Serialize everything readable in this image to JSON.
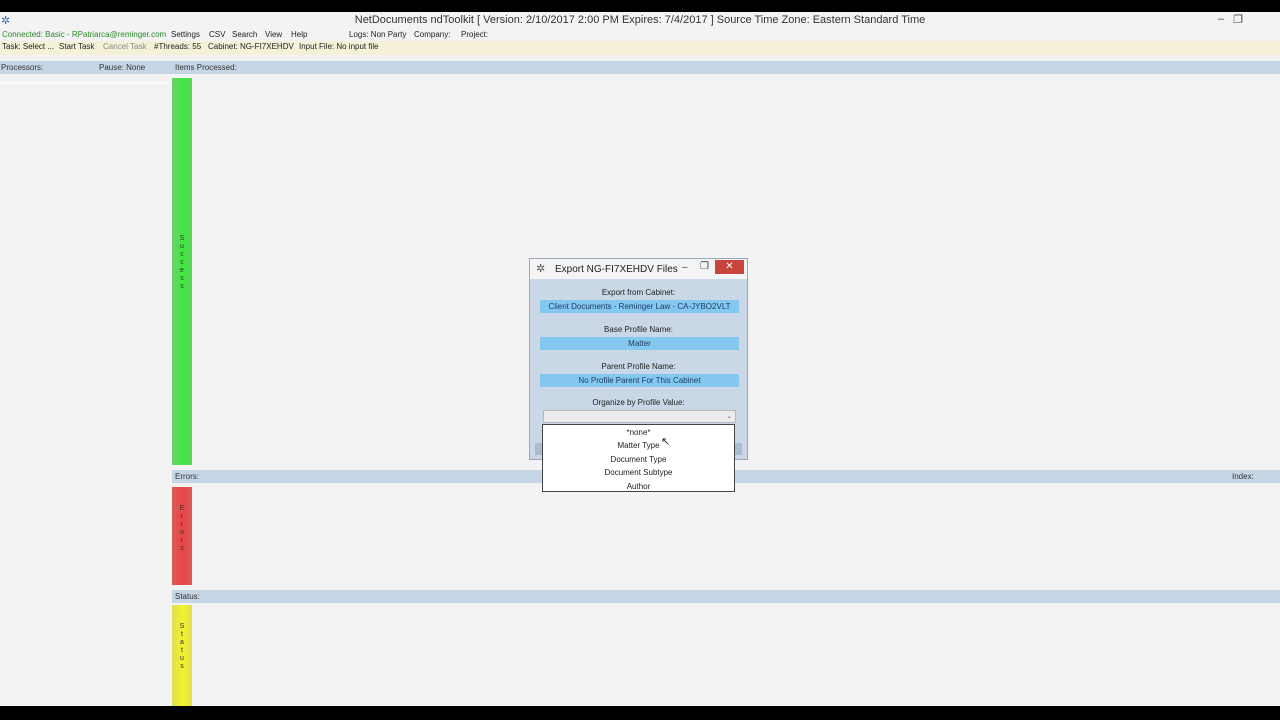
{
  "window": {
    "title": "NetDocuments ndToolkit  [ Version: 2/10/2017  2:00 PM  Expires: 7/4/2017 ]  Source Time Zone: Eastern Standard Time",
    "icons": {
      "app": "gear-icon",
      "minimize": "minimize-icon",
      "restore": "restore-icon"
    }
  },
  "menubar": {
    "connection": "Connected: Basic - RPatriarca@reminger.com",
    "items": [
      "Settings",
      "CSV",
      "Search",
      "View",
      "Help"
    ],
    "logs": "Logs: Non Party",
    "company": "Company:",
    "project": "Project:"
  },
  "taskbar": {
    "task": "Task: Select ...",
    "start": "Start Task",
    "cancel": "Cancel Task",
    "threads": "#Threads: 55",
    "cabinet": "Cabinet: NG-FI7XEHDV",
    "input_file": "Input File: No input file"
  },
  "processors_bar": {
    "processors": "Processors:",
    "pause": "Pause: None",
    "items": "Items Processed:"
  },
  "errors_bar": {
    "errors": "Errors:",
    "index": "Index:"
  },
  "status_bar": {
    "status": "Status:"
  },
  "panels": {
    "success": [
      "S",
      "u",
      "c",
      "c",
      "e",
      "s",
      "s"
    ],
    "errors": [
      "E",
      "r",
      "r",
      "o",
      "r",
      "s"
    ],
    "status": [
      "S",
      "t",
      "a",
      "t",
      "u",
      "s"
    ]
  },
  "colors": {
    "success": "#3fe83f",
    "errors": "#ea4646",
    "status": "#f2f22a",
    "field": "#84c8f0",
    "close": "#c9443d"
  },
  "dialog": {
    "title": "Export NG-FI7XEHDV Files",
    "export_from_label": "Export from Cabinet:",
    "export_from_value": "Client Documents - Reminger Law - CA-JYBO2VLT",
    "base_profile_label": "Base Profile Name:",
    "base_profile_value": "Matter",
    "parent_profile_label": "Parent Profile Name:",
    "parent_profile_value": "No Profile Parent For This Cabinet",
    "organize_label": "Organize by Profile Value:",
    "organize_options": [
      "*none*",
      "Matter Type",
      "Document Type",
      "Document Subtype",
      "Author"
    ]
  }
}
